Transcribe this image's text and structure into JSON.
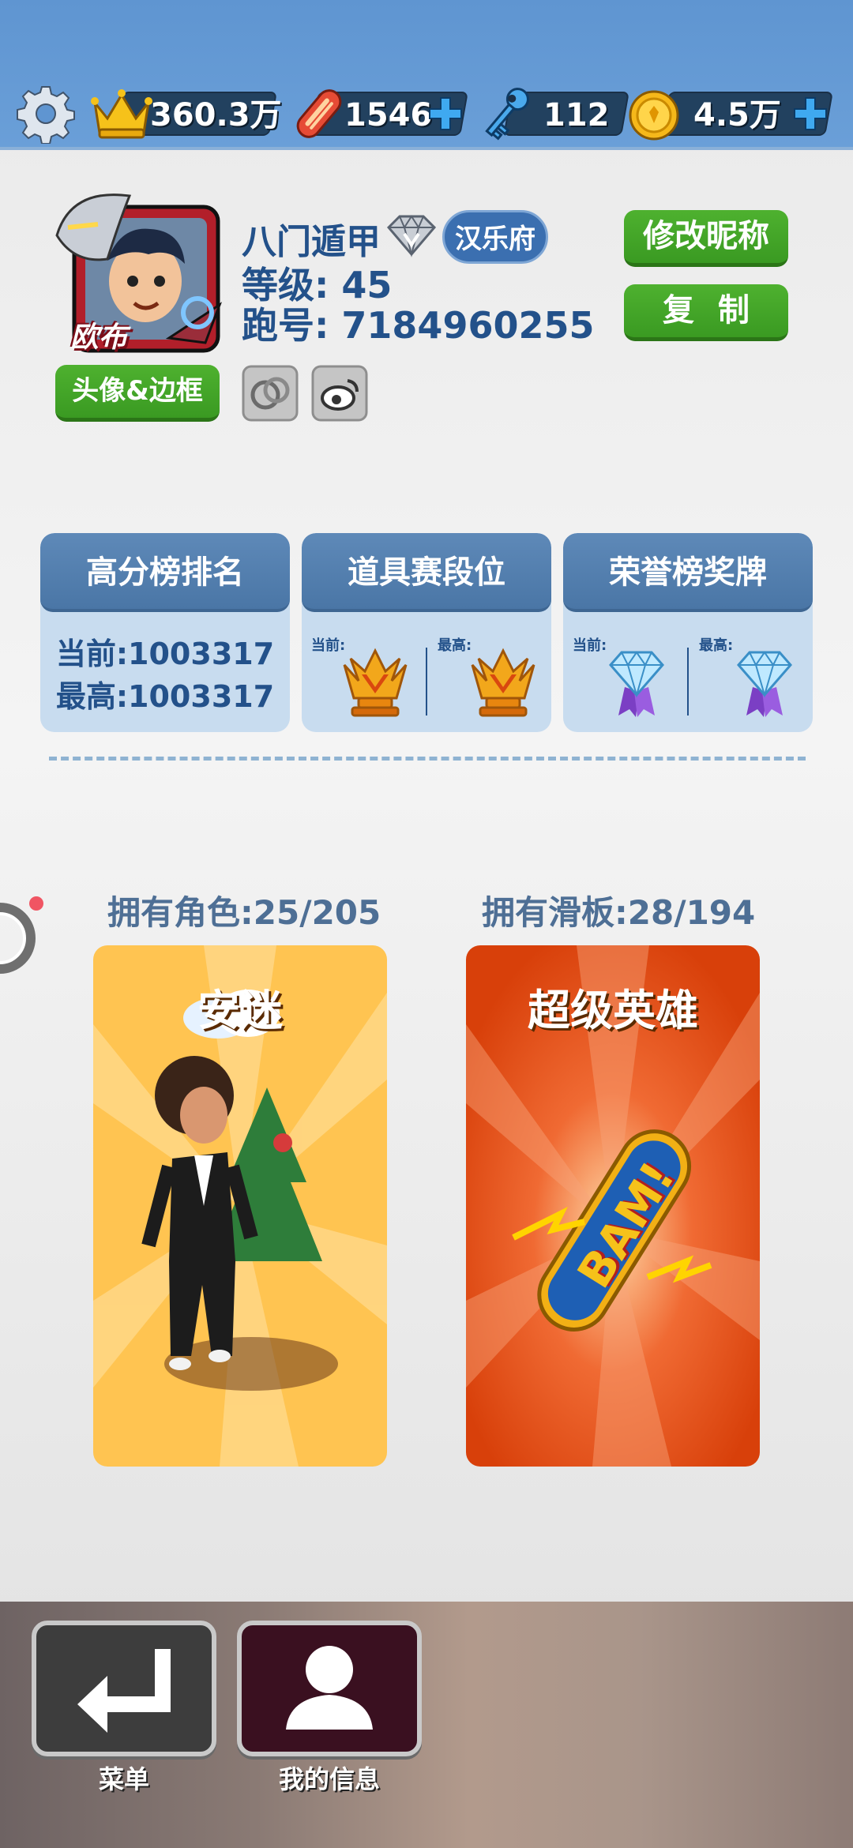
{
  "resources": {
    "crown_value": "360.3万",
    "board_value": "1546",
    "key_value": "112",
    "coin_value": "4.5万"
  },
  "profile": {
    "avatar_caption": "欧布",
    "nickname": "八门遁甲",
    "city": "汉乐府",
    "level_text": "等级: 45",
    "runner_id_text": "跑号: 7184960255",
    "rename_button": "修改昵称",
    "copy_button": "复制",
    "avatar_frame_button": "头像&边框"
  },
  "stats": {
    "highscore": {
      "title": "高分榜排名",
      "current_text": "当前:1003317",
      "best_text": "最高:1003317"
    },
    "item_tier": {
      "title": "道具赛段位",
      "current_label": "当前:",
      "best_label": "最高:"
    },
    "honor": {
      "title": "荣誉榜奖牌",
      "current_label": "当前:",
      "best_label": "最高:"
    }
  },
  "collection": {
    "characters_owned": "拥有角色:25/205",
    "boards_owned": "拥有滑板:28/194",
    "character_name": "安迷",
    "board_name": "超级英雄",
    "board_art_text": "BAM!"
  },
  "bottom_nav": {
    "menu_label": "菜单",
    "my_info_label": "我的信息"
  }
}
